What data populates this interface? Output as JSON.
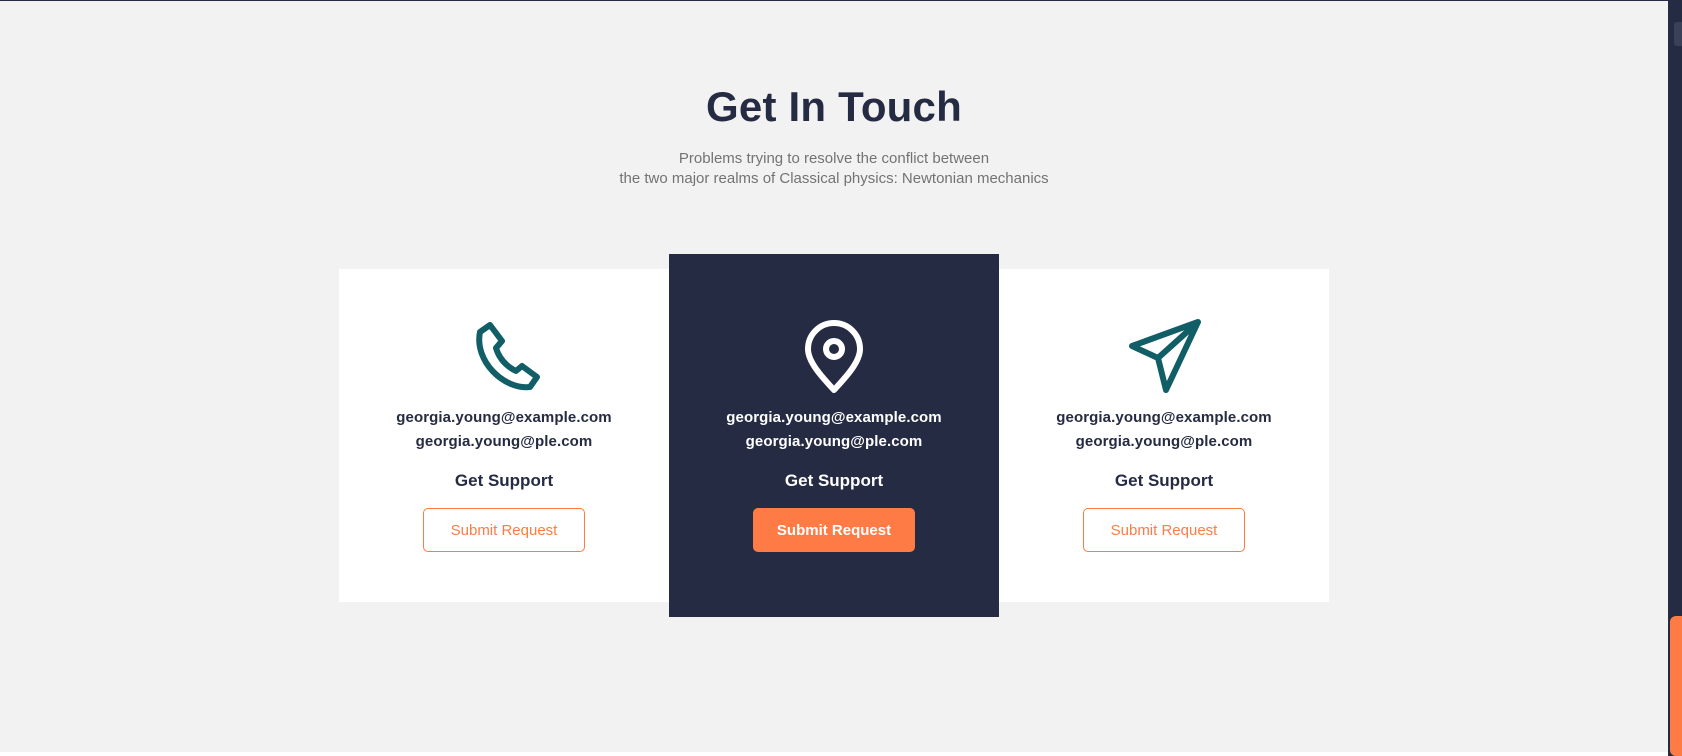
{
  "section": {
    "title": "Get In Touch",
    "subtitle_line1": "Problems trying to resolve the conflict between",
    "subtitle_line2": "the two major realms of Classical physics: Newtonian mechanics"
  },
  "cards": [
    {
      "icon": "phone-icon",
      "email_primary": "georgia.young@example.com",
      "email_secondary": "georgia.young@ple.com",
      "heading": "Get Support",
      "button_label": "Submit Request"
    },
    {
      "icon": "location-pin-icon",
      "email_primary": "georgia.young@example.com",
      "email_secondary": "georgia.young@ple.com",
      "heading": "Get Support",
      "button_label": "Submit Request"
    },
    {
      "icon": "send-icon",
      "email_primary": "georgia.young@example.com",
      "email_secondary": "georgia.young@ple.com",
      "heading": "Get Support",
      "button_label": "Submit Request"
    }
  ],
  "colors": {
    "dark_navy": "#252b42",
    "accent_orange": "#ff7b45",
    "icon_teal": "#115e67",
    "background": "#f2f2f2",
    "muted_text": "#737373"
  }
}
